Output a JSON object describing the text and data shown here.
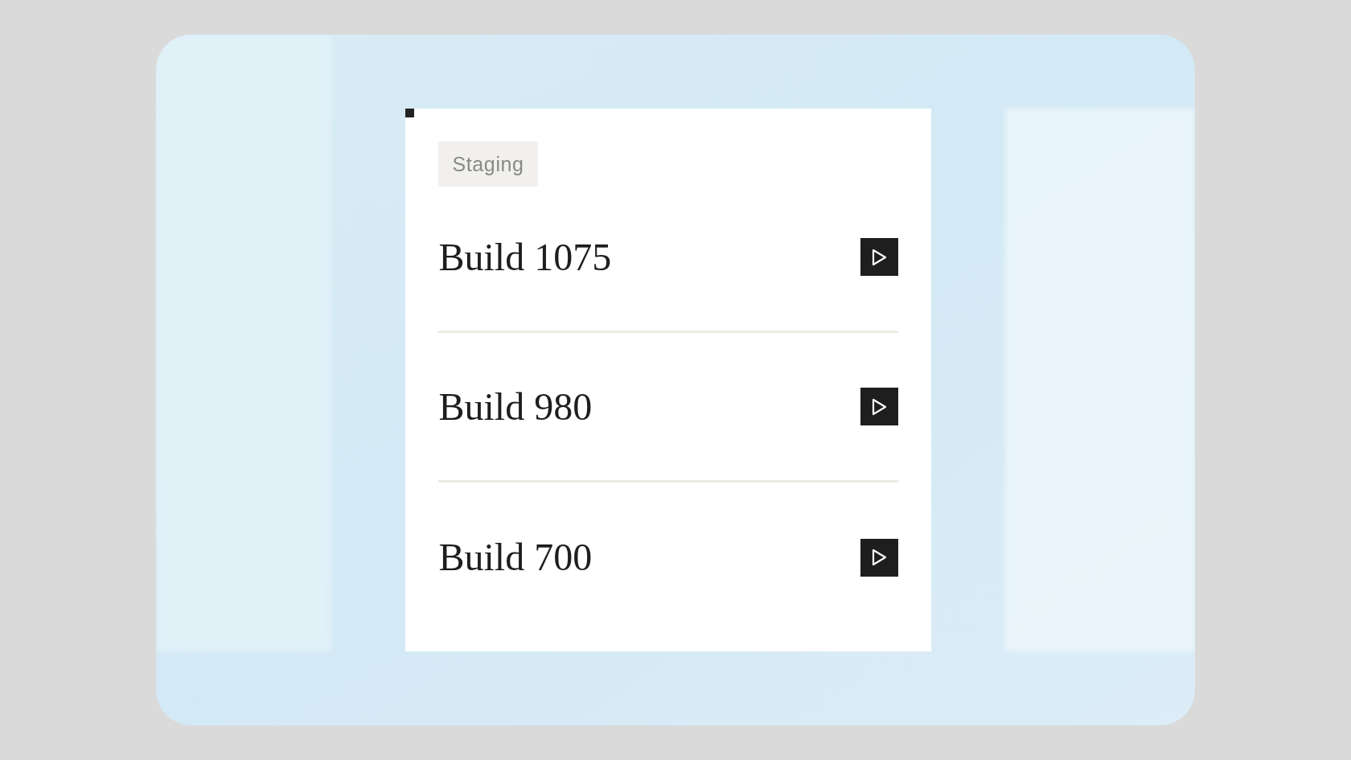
{
  "badge": "Staging",
  "builds": [
    {
      "title": "Build 1075"
    },
    {
      "title": "Build 980"
    },
    {
      "title": "Build 700"
    }
  ]
}
